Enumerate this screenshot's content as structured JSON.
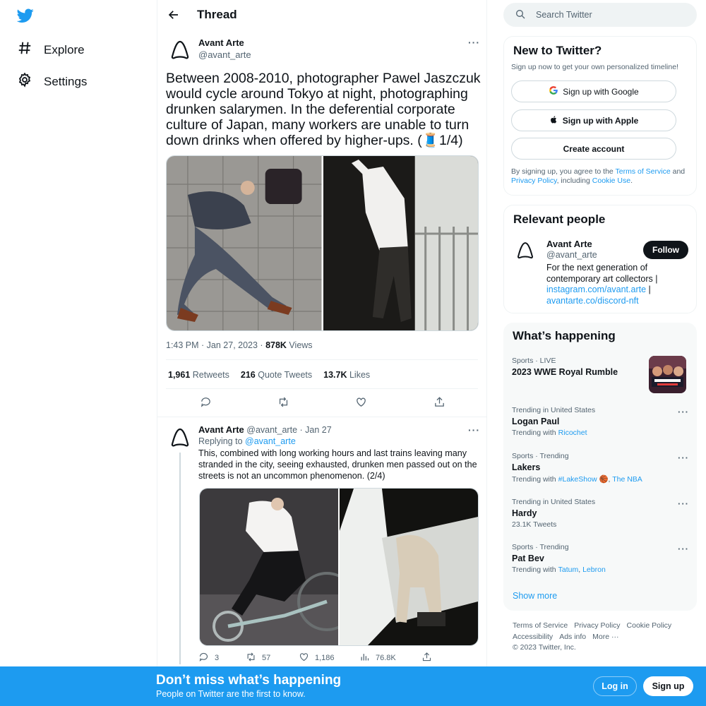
{
  "nav": {
    "items": [
      {
        "label": "Explore",
        "icon": "hashtag-icon"
      },
      {
        "label": "Settings",
        "icon": "gear-icon"
      }
    ]
  },
  "thread": {
    "title": "Thread",
    "main_tweet": {
      "author_name": "Avant Arte",
      "author_handle": "@avant_arte",
      "text": "Between 2008-2010, photographer Pawel Jaszczuk would cycle around Tokyo at night, photographing drunken salarymen. In the deferential corporate culture of Japan, many workers are unable to turn down drinks when offered by higher-ups. (🧵1/4)",
      "time": "1:43 PM · Jan 27, 2023 · ",
      "views_count": "878K",
      "views_label": " Views",
      "retweets_count": "1,961",
      "retweets_label": "Retweets",
      "quotes_count": "216",
      "quotes_label": "Quote Tweets",
      "likes_count": "13.7K",
      "likes_label": "Likes"
    },
    "reply_tweet": {
      "author_name": "Avant Arte",
      "author_handle": "@avant_arte",
      "date": "· Jan 27",
      "replying_label": "Replying to ",
      "replying_handle": "@avant_arte",
      "text": "This, combined with long working hours and last trains leaving many stranded in the city, seeing exhausted, drunken men passed out on the streets is not an uncommon phenomenon. (2/4)",
      "replies": "3",
      "retweets": "57",
      "likes": "1,186",
      "views": "76.8K"
    }
  },
  "sidebar": {
    "search_placeholder": "Search Twitter",
    "new_to_twitter": {
      "title": "New to Twitter?",
      "subtitle": "Sign up now to get your own personalized timeline!",
      "google": "Sign up with Google",
      "apple": "Sign up with Apple",
      "create": "Create account",
      "legal_prefix": "By signing up, you agree to the ",
      "terms": "Terms of Service",
      "and": " and ",
      "privacy": "Privacy Policy",
      "including": ", including ",
      "cookie": "Cookie Use",
      "period": "."
    },
    "relevant_people": {
      "title": "Relevant people",
      "name": "Avant Arte",
      "handle": "@avant_arte",
      "follow": "Follow",
      "bio": "For the next generation of contemporary art collectors | ",
      "link1": "instagram.com/avant.arte",
      "sep": " | ",
      "link2": "avantarte.co/discord-nft"
    },
    "whats_happening": {
      "title": "What’s happening",
      "trends": [
        {
          "context": "Sports · LIVE",
          "name": "2023 WWE Royal Rumble",
          "sub": "",
          "links": []
        },
        {
          "context": "Trending in United States",
          "name": "Logan Paul",
          "sub": "Trending with",
          "links": [
            "Ricochet"
          ]
        },
        {
          "context": "Sports · Trending",
          "name": "Lakers",
          "sub": "Trending with",
          "links": [
            "#LakeShow 🏀",
            "The NBA"
          ]
        },
        {
          "context": "Trending in United States",
          "name": "Hardy",
          "sub": "23.1K Tweets",
          "links": []
        },
        {
          "context": "Sports · Trending",
          "name": "Pat Bev",
          "sub": "Trending with",
          "links": [
            "Tatum",
            "Lebron"
          ]
        }
      ],
      "show_more": "Show more"
    },
    "footer": {
      "links": [
        "Terms of Service",
        "Privacy Policy",
        "Cookie Policy",
        "Accessibility",
        "Ads info",
        "More ···"
      ],
      "copyright": "© 2023 Twitter, Inc."
    }
  },
  "bottom_bar": {
    "title": "Don’t miss what’s happening",
    "subtitle": "People on Twitter are the first to know.",
    "login": "Log in",
    "signup": "Sign up"
  },
  "colors": {
    "accent": "#1d9bf0",
    "text": "#0f1419",
    "muted": "#536471"
  }
}
